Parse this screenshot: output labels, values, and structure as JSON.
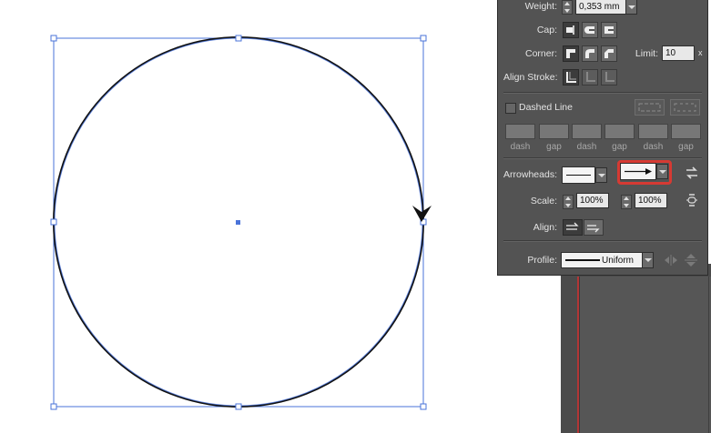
{
  "stroke_panel": {
    "weight": {
      "label": "Weight:",
      "value": "0,353 mm"
    },
    "cap": {
      "label": "Cap:"
    },
    "corner": {
      "label": "Corner:",
      "limit_label": "Limit:",
      "limit_value": "10",
      "limit_suffix": "x"
    },
    "align_stroke": {
      "label": "Align Stroke:"
    },
    "dashed_line": {
      "label": "Dashed Line",
      "checked": false
    },
    "dash_gap_labels": [
      "dash",
      "gap",
      "dash",
      "gap",
      "dash",
      "gap"
    ],
    "arrowheads": {
      "label": "Arrowheads:",
      "start": "none",
      "end": "arrow"
    },
    "scale": {
      "label": "Scale:",
      "start_value": "100%",
      "end_value": "100%"
    },
    "align": {
      "label": "Align:"
    },
    "profile": {
      "label": "Profile:",
      "value": "Uniform"
    }
  },
  "colors": {
    "selection": "#4a73d9",
    "panel_bg": "#535353",
    "highlight": "#d63a33"
  }
}
